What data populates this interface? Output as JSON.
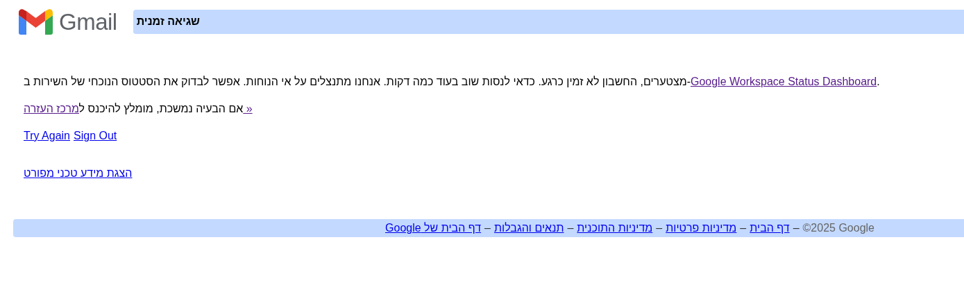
{
  "header": {
    "logo_text": "Gmail",
    "title": "שגיאה זמנית"
  },
  "message": {
    "text": "מצטערים, החשבון לא זמין כרגע. כדאי לנסות שוב בעוד כמה דקות. אנחנו מתנצלים על אי הנוחות. אפשר לבדוק את הסטטוס הנוכחי של השירות ב-",
    "link": {
      "label": "Google Workspace Status Dashboard",
      "visited": true
    },
    "end": "."
  },
  "help": {
    "text": "אם הבעיה נמשכת, מומלץ להיכנס ל",
    "link": {
      "label": "מרכז העזרה",
      "visited": true
    },
    "arrow_link": {
      "label": " »",
      "visited": true
    }
  },
  "try_again": {
    "label": "Try Again",
    "visited": false
  },
  "sign_out": {
    "label": "Sign Out",
    "visited": false
  },
  "details_link": {
    "label": "הצגת מידע טכני מפורט",
    "visited": false
  },
  "footer": {
    "copyright": "©2025 Google",
    "separator": "–",
    "links": [
      {
        "label": "דף הבית",
        "visited": false
      },
      {
        "label": "מדיניות פרטיות",
        "visited": false
      },
      {
        "label": "מדיניות התוכנית",
        "visited": false
      },
      {
        "label": "תנאים והגבלות",
        "visited": false
      },
      {
        "label": "דף הבית של Google",
        "visited": false
      }
    ]
  }
}
